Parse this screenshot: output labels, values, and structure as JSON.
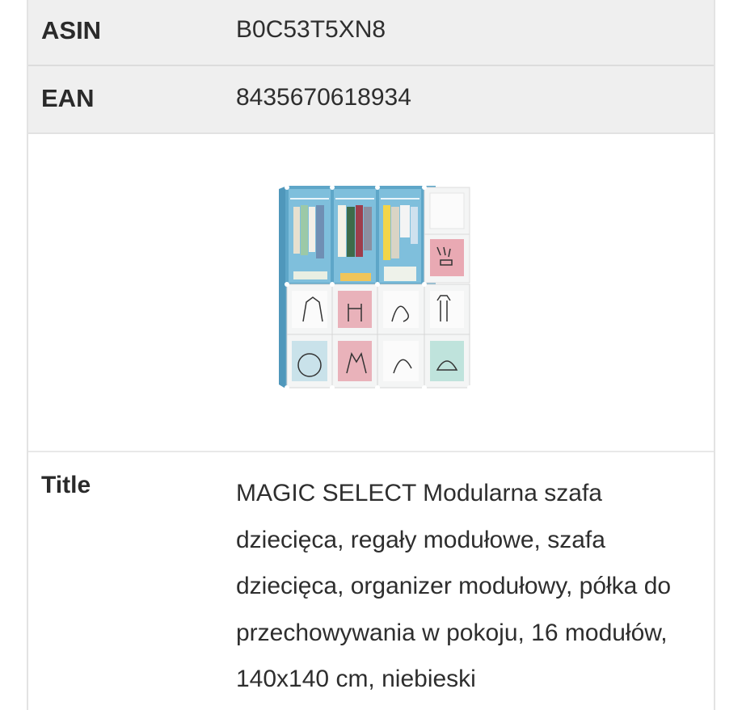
{
  "rows": {
    "asin": {
      "label": "ASIN",
      "value": "B0C53T5XN8"
    },
    "ean": {
      "label": "EAN",
      "value": "8435670618934"
    },
    "title": {
      "label": "Title",
      "value": "MAGIC SELECT Modularna szafa dziecięca, regały modułowe, szafa dziecięca, organizer modułowy, półka do przechowywania w pokoju, 16 modułów, 140x140 cm, niebieski"
    }
  },
  "image": {
    "icon": "product-wardrobe-image"
  },
  "colors": {
    "row_gray": "#efefef",
    "border": "#e3e3e3",
    "wardrobe_blue": "#5ea6c8"
  }
}
